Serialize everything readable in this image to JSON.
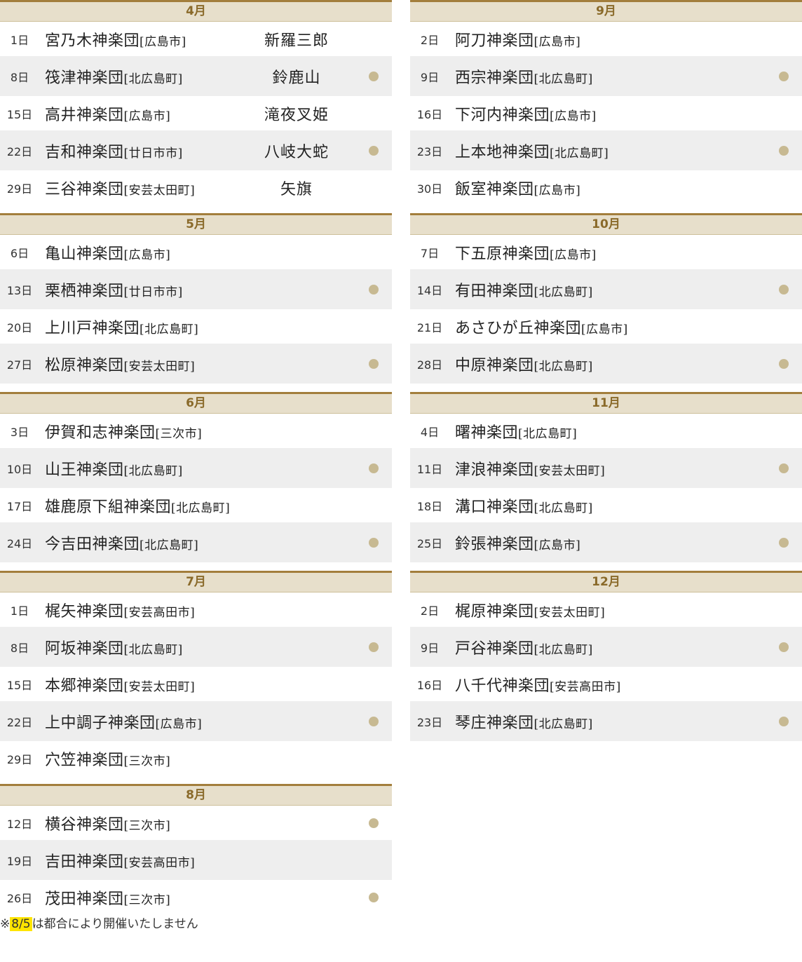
{
  "columns": [
    {
      "months": [
        {
          "label": "4月",
          "rows": [
            {
              "day": "1日",
              "group": "宮乃木神楽団",
              "place": "[広島市]",
              "program": "新羅三郎",
              "dot": false
            },
            {
              "day": "8日",
              "group": "筏津神楽団",
              "place": "[北広島町]",
              "program": "鈴鹿山",
              "dot": true
            },
            {
              "day": "15日",
              "group": "高井神楽団",
              "place": "[広島市]",
              "program": "滝夜叉姫",
              "dot": false
            },
            {
              "day": "22日",
              "group": "吉和神楽団",
              "place": "[廿日市市]",
              "program": "八岐大蛇",
              "dot": true
            },
            {
              "day": "29日",
              "group": "三谷神楽団",
              "place": "[安芸太田町]",
              "program": "矢旗",
              "dot": false
            }
          ]
        },
        {
          "label": "5月",
          "rows": [
            {
              "day": "6日",
              "group": "亀山神楽団",
              "place": "[広島市]",
              "program": "",
              "dot": false
            },
            {
              "day": "13日",
              "group": "栗栖神楽団",
              "place": "[廿日市市]",
              "program": "",
              "dot": true
            },
            {
              "day": "20日",
              "group": "上川戸神楽団",
              "place": "[北広島町]",
              "program": "",
              "dot": false
            },
            {
              "day": "27日",
              "group": "松原神楽団",
              "place": "[安芸太田町]",
              "program": "",
              "dot": true
            }
          ]
        },
        {
          "label": "6月",
          "rows": [
            {
              "day": "3日",
              "group": "伊賀和志神楽団",
              "place": "[三次市]",
              "program": "",
              "dot": false
            },
            {
              "day": "10日",
              "group": "山王神楽団",
              "place": "[北広島町]",
              "program": "",
              "dot": true
            },
            {
              "day": "17日",
              "group": "雄鹿原下組神楽団",
              "place": "[北広島町]",
              "program": "",
              "dot": false
            },
            {
              "day": "24日",
              "group": "今吉田神楽団",
              "place": "[北広島町]",
              "program": "",
              "dot": true
            }
          ]
        },
        {
          "label": "7月",
          "rows": [
            {
              "day": "1日",
              "group": "梶矢神楽団",
              "place": "[安芸高田市]",
              "program": "",
              "dot": false
            },
            {
              "day": "8日",
              "group": "阿坂神楽団",
              "place": "[北広島町]",
              "program": "",
              "dot": true
            },
            {
              "day": "15日",
              "group": "本郷神楽団",
              "place": "[安芸太田町]",
              "program": "",
              "dot": false
            },
            {
              "day": "22日",
              "group": "上中調子神楽団",
              "place": "[広島市]",
              "program": "",
              "dot": true
            },
            {
              "day": "29日",
              "group": "穴笠神楽団",
              "place": "[三次市]",
              "program": "",
              "dot": false
            }
          ]
        },
        {
          "label": "8月",
          "rows": [
            {
              "day": "12日",
              "group": "横谷神楽団",
              "place": "[三次市]",
              "program": "",
              "dot": true
            },
            {
              "day": "19日",
              "group": "吉田神楽団",
              "place": "[安芸高田市]",
              "program": "",
              "dot": false
            },
            {
              "day": "26日",
              "group": "茂田神楽団",
              "place": "[三次市]",
              "program": "",
              "dot": true
            }
          ]
        }
      ]
    },
    {
      "months": [
        {
          "label": "9月",
          "rows": [
            {
              "day": "2日",
              "group": "阿刀神楽団",
              "place": "[広島市]",
              "program": "",
              "dot": false
            },
            {
              "day": "9日",
              "group": "西宗神楽団",
              "place": "[北広島町]",
              "program": "",
              "dot": true
            },
            {
              "day": "16日",
              "group": "下河内神楽団",
              "place": "[広島市]",
              "program": "",
              "dot": false
            },
            {
              "day": "23日",
              "group": "上本地神楽団",
              "place": "[北広島町]",
              "program": "",
              "dot": true
            },
            {
              "day": "30日",
              "group": "飯室神楽団",
              "place": "[広島市]",
              "program": "",
              "dot": false
            }
          ]
        },
        {
          "label": "10月",
          "rows": [
            {
              "day": "7日",
              "group": "下五原神楽団",
              "place": "[広島市]",
              "program": "",
              "dot": false
            },
            {
              "day": "14日",
              "group": "有田神楽団",
              "place": "[北広島町]",
              "program": "",
              "dot": true
            },
            {
              "day": "21日",
              "group": "あさひが丘神楽団",
              "place": "[広島市]",
              "program": "",
              "dot": false
            },
            {
              "day": "28日",
              "group": "中原神楽団",
              "place": "[北広島町]",
              "program": "",
              "dot": true
            }
          ]
        },
        {
          "label": "11月",
          "rows": [
            {
              "day": "4日",
              "group": "曙神楽団",
              "place": "[北広島町]",
              "program": "",
              "dot": false
            },
            {
              "day": "11日",
              "group": "津浪神楽団",
              "place": "[安芸太田町]",
              "program": "",
              "dot": true
            },
            {
              "day": "18日",
              "group": "溝口神楽団",
              "place": "[北広島町]",
              "program": "",
              "dot": false
            },
            {
              "day": "25日",
              "group": "鈴張神楽団",
              "place": "[広島市]",
              "program": "",
              "dot": true
            }
          ]
        },
        {
          "label": "12月",
          "rows": [
            {
              "day": "2日",
              "group": "梶原神楽団",
              "place": "[安芸太田町]",
              "program": "",
              "dot": false
            },
            {
              "day": "9日",
              "group": "戸谷神楽団",
              "place": "[北広島町]",
              "program": "",
              "dot": true
            },
            {
              "day": "16日",
              "group": "八千代神楽団",
              "place": "[安芸高田市]",
              "program": "",
              "dot": false
            },
            {
              "day": "23日",
              "group": "琴庄神楽団",
              "place": "[北広島町]",
              "program": "",
              "dot": true
            }
          ]
        }
      ]
    }
  ],
  "note": {
    "prefix": "※",
    "highlight": "8/5",
    "suffix": "は都合により開催いたしません"
  },
  "colors": {
    "accent_line": "#a37e3c",
    "header_bg": "#e7dfcb",
    "header_text": "#8a6a2a",
    "row_shade": "#eeeeee",
    "dot": "#c7b992",
    "highlight": "#ffe500"
  }
}
